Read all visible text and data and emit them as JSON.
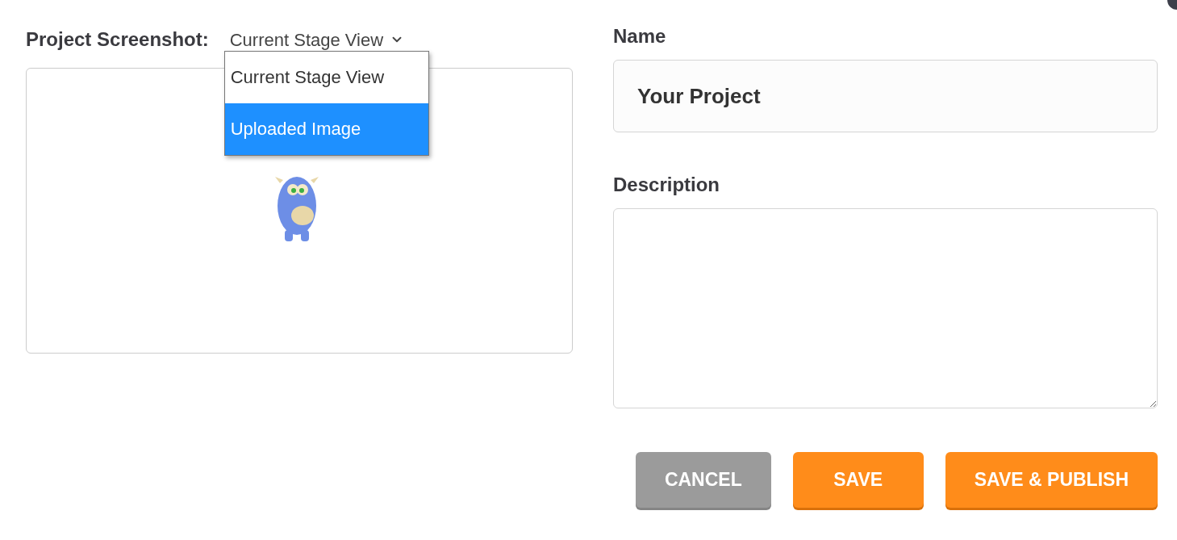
{
  "screenshot": {
    "label": "Project Screenshot:",
    "select": {
      "value": "Current Stage View",
      "expanded": true,
      "options": [
        {
          "label": "Current Stage View",
          "highlighted": false
        },
        {
          "label": "Uploaded Image",
          "highlighted": true
        }
      ]
    }
  },
  "name": {
    "label": "Name",
    "value": "Your Project"
  },
  "description": {
    "label": "Description"
  },
  "buttons": [
    {
      "label": "CANCEL",
      "kind": "secondary"
    },
    {
      "label": "SAVE",
      "kind": "primary"
    },
    {
      "label": "SAVE & PUBLISH",
      "kind": "primary"
    }
  ]
}
